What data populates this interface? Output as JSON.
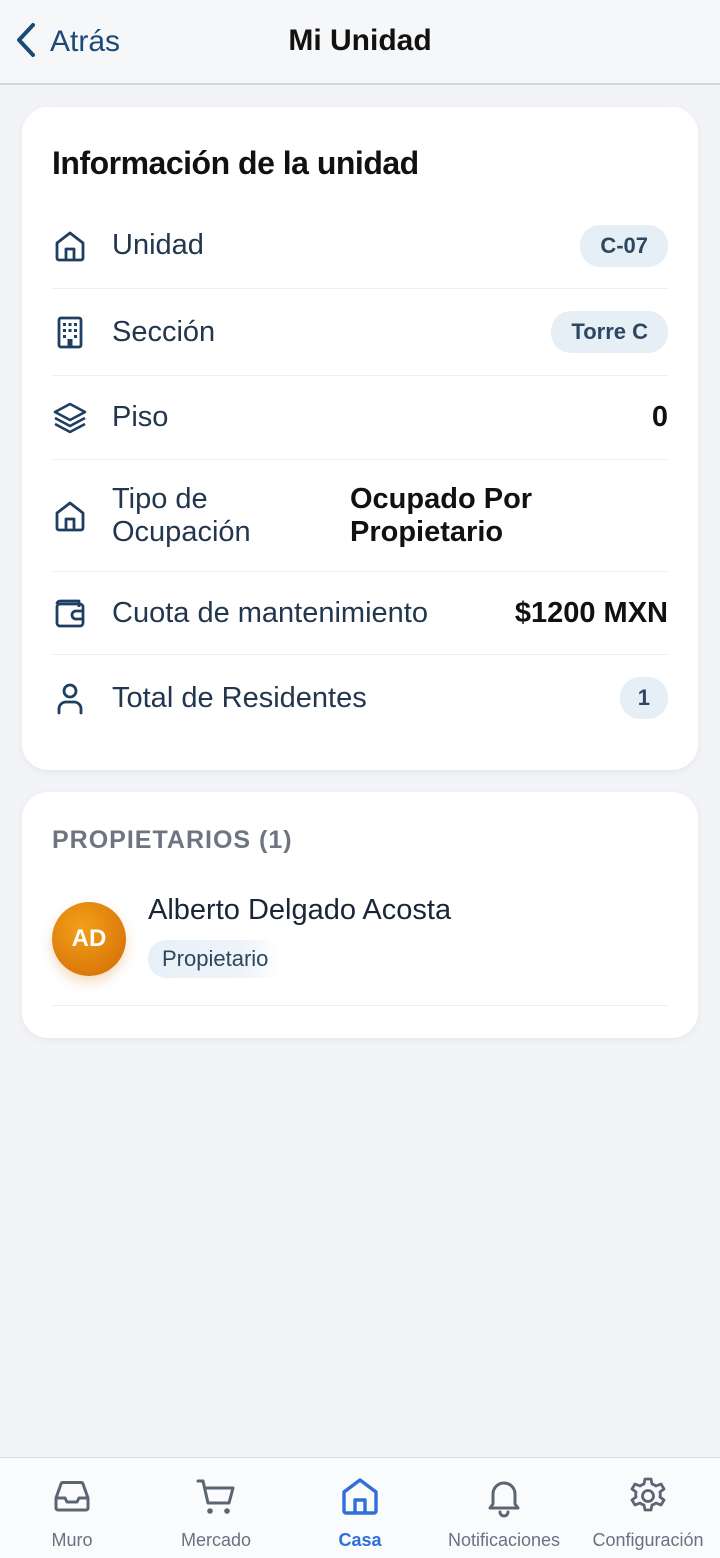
{
  "header": {
    "back_label": "Atrás",
    "title": "Mi Unidad"
  },
  "unit_info": {
    "title": "Información de la unidad",
    "rows": {
      "unidad": {
        "label": "Unidad",
        "value": "C-07",
        "icon": "home-icon"
      },
      "seccion": {
        "label": "Sección",
        "value": "Torre C",
        "icon": "building-icon"
      },
      "piso": {
        "label": "Piso",
        "value": "0",
        "icon": "layers-icon"
      },
      "ocupacion": {
        "label": "Tipo de Ocupación",
        "value": "Ocupado Por Propietario",
        "icon": "home-icon"
      },
      "cuota": {
        "label": "Cuota de mantenimiento",
        "value": "$1200 MXN",
        "icon": "wallet-icon"
      },
      "residentes": {
        "label": "Total de Residentes",
        "value": "1",
        "icon": "user-icon"
      }
    }
  },
  "owners": {
    "title": "PROPIETARIOS (1)",
    "items": [
      {
        "initials": "AD",
        "name": "Alberto Delgado Acosta",
        "role": "Propietario"
      }
    ]
  },
  "tabs": [
    {
      "label": "Muro",
      "icon": "inbox-icon"
    },
    {
      "label": "Mercado",
      "icon": "cart-icon"
    },
    {
      "label": "Casa",
      "icon": "home-icon"
    },
    {
      "label": "Notificaciones",
      "icon": "bell-icon"
    },
    {
      "label": "Configuración",
      "icon": "gear-icon"
    }
  ],
  "colors": {
    "accent": "#2f6fd9",
    "avatar": "#e08410"
  }
}
